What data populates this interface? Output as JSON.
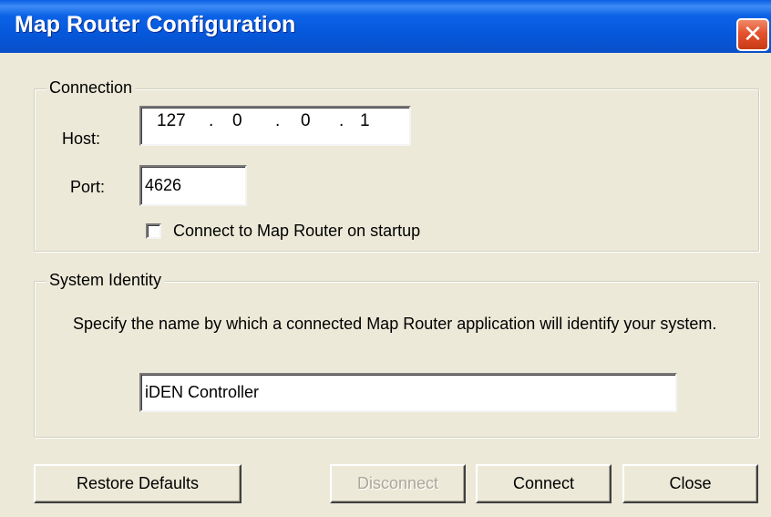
{
  "window": {
    "title": "Map Router Configuration",
    "close_glyph": "✕",
    "accent_color": "#0556D8",
    "close_color": "#E4532D"
  },
  "connection": {
    "legend": "Connection",
    "host_label": "Host:",
    "host_octets": [
      "127",
      "0",
      "0",
      "1"
    ],
    "ip_separator": ".",
    "port_label": "Port:",
    "port_value": "4626",
    "startup_checkbox_label": "Connect to Map Router on startup",
    "startup_checked": false
  },
  "identity": {
    "legend": "System Identity",
    "description": "Specify the name by which a connected Map Router application will identify your system.",
    "name_value": "iDEN Controller"
  },
  "buttons": {
    "restore_defaults": "Restore Defaults",
    "disconnect": "Disconnect",
    "connect": "Connect",
    "close": "Close"
  }
}
